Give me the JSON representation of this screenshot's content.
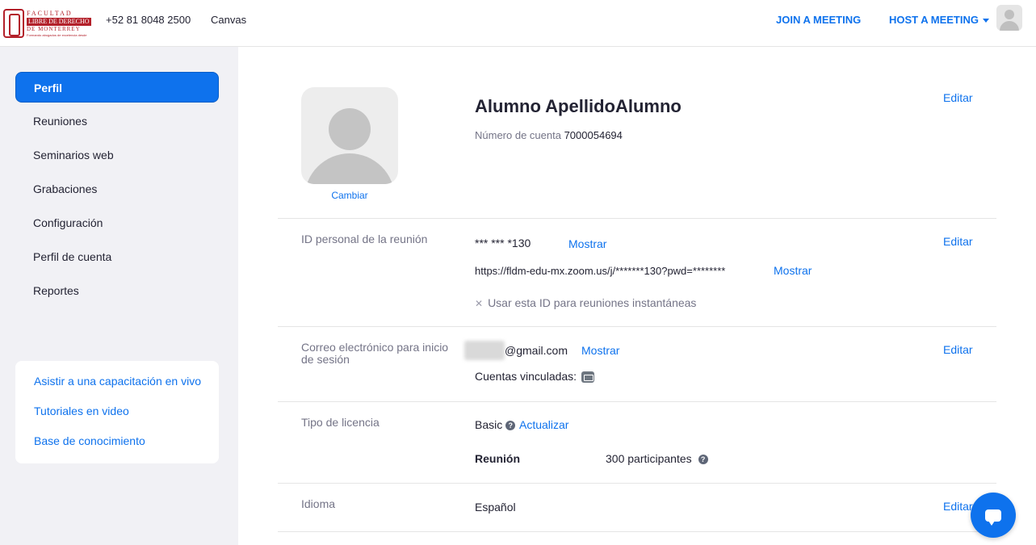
{
  "header": {
    "logo": {
      "line1": "FACULTAD",
      "line2": "LIBRE DE DERECHO",
      "line3": "DE MONTERREY",
      "line4": "Formando abogados de excelencia desde"
    },
    "phone": "+52 81 8048 2500",
    "canvas": "Canvas",
    "join": "JOIN A MEETING",
    "host": "HOST A MEETING"
  },
  "sidebar": {
    "items": [
      {
        "label": "Perfil"
      },
      {
        "label": "Reuniones"
      },
      {
        "label": "Seminarios web"
      },
      {
        "label": "Grabaciones"
      },
      {
        "label": "Configuración"
      },
      {
        "label": "Perfil de cuenta"
      },
      {
        "label": "Reportes"
      }
    ],
    "help": [
      {
        "label": "Asistir a una capacitación en vivo"
      },
      {
        "label": "Tutoriales en video"
      },
      {
        "label": "Base de conocimiento"
      }
    ]
  },
  "profile": {
    "change": "Cambiar",
    "name": "Alumno ApellidoAlumno",
    "account_label": "Número de cuenta",
    "account_number": "7000054694",
    "edit": "Editar"
  },
  "meeting_id": {
    "label": "ID personal de la reunión",
    "masked_id": "*** *** *130",
    "show": "Mostrar",
    "url": "https://fldm-edu-mx.zoom.us/j/*******130?pwd=********",
    "instant_option": "Usar esta ID para reuniones instantáneas",
    "edit": "Editar"
  },
  "email": {
    "label": "Correo electrónico para inicio de sesión",
    "domain": "@gmail.com",
    "show": "Mostrar",
    "linked_label": "Cuentas vinculadas:",
    "edit": "Editar"
  },
  "license": {
    "label": "Tipo de licencia",
    "type": "Basic",
    "upgrade": "Actualizar",
    "meeting_label": "Reunión",
    "participants": "300 participantes"
  },
  "language": {
    "label": "Idioma",
    "value": "Español",
    "edit": "Editar"
  }
}
